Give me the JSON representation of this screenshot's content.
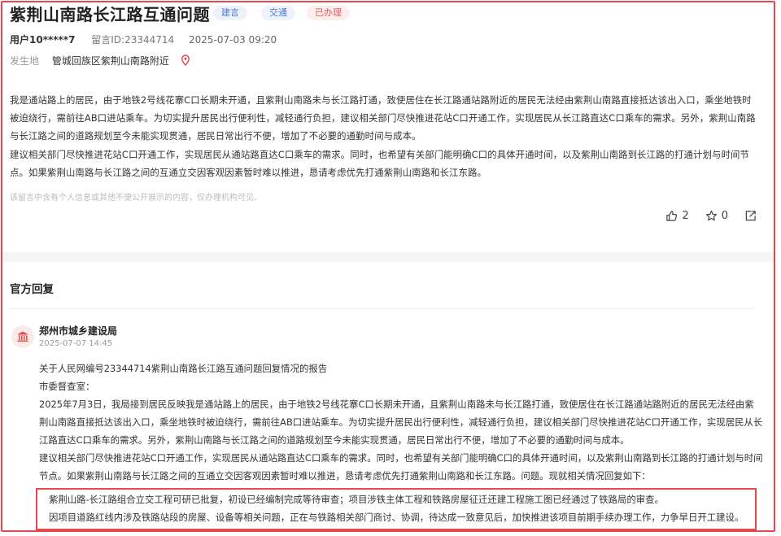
{
  "post": {
    "title": "紫荆山南路长江路互通问题",
    "tags": [
      "建言",
      "交通",
      "已办理"
    ],
    "user": "用户10*****7",
    "message_id": "留言ID:23344714",
    "datetime": "2025-07-03 09:20",
    "location_label": "发生地",
    "location": "管城回族区紫荆山南路附近",
    "paragraphs": [
      "我是通站路上的居民，由于地铁2号线花寨C口长期未开通，且紫荆山南路未与长江路打通，致使居住在长江路通站路附近的居民无法经由紫荆山南路直接抵达该出入口，乘坐地铁时被迫绕行，需前往AB口进站乘车。为切实提升居民出行便利性，减轻通行负担，建议相关部门尽快推进花站C口开通工作，实现居民从长江路直达C口乘车的需求。另外，紫荆山南路与长江路之间的道路规划至今未能实现贯通，居民日常出行不便，增加了不必要的通勤时间与成本。",
      "建议相关部门尽快推进花站C口开通工作，实现居民从通站路直达C口乘车的需求。同时，也希望有关部门能明确C口的具体开通时间，以及紫荆山南路到长江路的打通计划与时间节点。如果紫荆山南路与长江路之间的互通立交因客观因素暂时难以推进，恳请考虑优先打通紫荆山南路和长江东路。"
    ],
    "disclaimer": "该留言中含有个人信息或其他不便公开展示的内容，仅办理机构可见。",
    "like_count": "2",
    "star_count": "0"
  },
  "reply": {
    "section_title": "官方回复",
    "org_name": "郑州市城乡建设局",
    "date": "2025-07-07 14:45",
    "lines": [
      "关于人民网编号23344714紫荆山南路长江路互通问题回复情况的报告",
      "市委督查室：",
      "2025年7月3日，我局接到居民反映我是通站路上的居民，由于地铁2号线花寨C口长期未开通，且紫荆山南路未与长江路打通，致使居住在长江路通站路附近的居民无法经由紫荆山南路直接抵达该出入口，乘坐地铁时被迫绕行，需前往AB口进站乘车。为切实提升居民出行便利性，减轻通行负担，建议相关部门尽快推进花站C口开通工作，实现居民从长江路直达C口乘车的需求。另外，紫荆山南路与长江路之间的道路规划至今未能实现贯通，居民日常出行不便，增加了不必要的通勤时间与成本。",
      "建议相关部门尽快推进花站C口开通工作，实现居民从通站路直达C口乘车的需求。同时，也希望有关部门能明确C口的具体开通时间，以及紫荆山南路到长江路的打通计划与时间节点。如果紫荆山南路与长江路之间的互通立交因客观因素暂时难以推进，恳请考虑优先打通紫荆山南路和长江东路。问题。现就相关情况回复如下："
    ],
    "highlight": [
      "紫荆山路-长江路组合立交工程可研已批复，初设已经编制完成等待审查；项目涉铁主体工程和铁路房屋征迁还建工程施工图已经通过了铁路局的审查。",
      "因项目道路红线内涉及铁路站段的房屋、设备等相关问题，正在与铁路相关部门商讨、协调，待达成一致意见后，加快推进该项目前期手续办理工作，力争早日开工建设。"
    ]
  },
  "colors": {
    "accent": "#e8474e",
    "tag_blue": "#4a7ad6",
    "tag_red": "#e05a5a"
  },
  "icons": [
    "location-pin-icon",
    "thumbs-up-icon",
    "star-icon",
    "share-icon",
    "government-building-icon"
  ]
}
